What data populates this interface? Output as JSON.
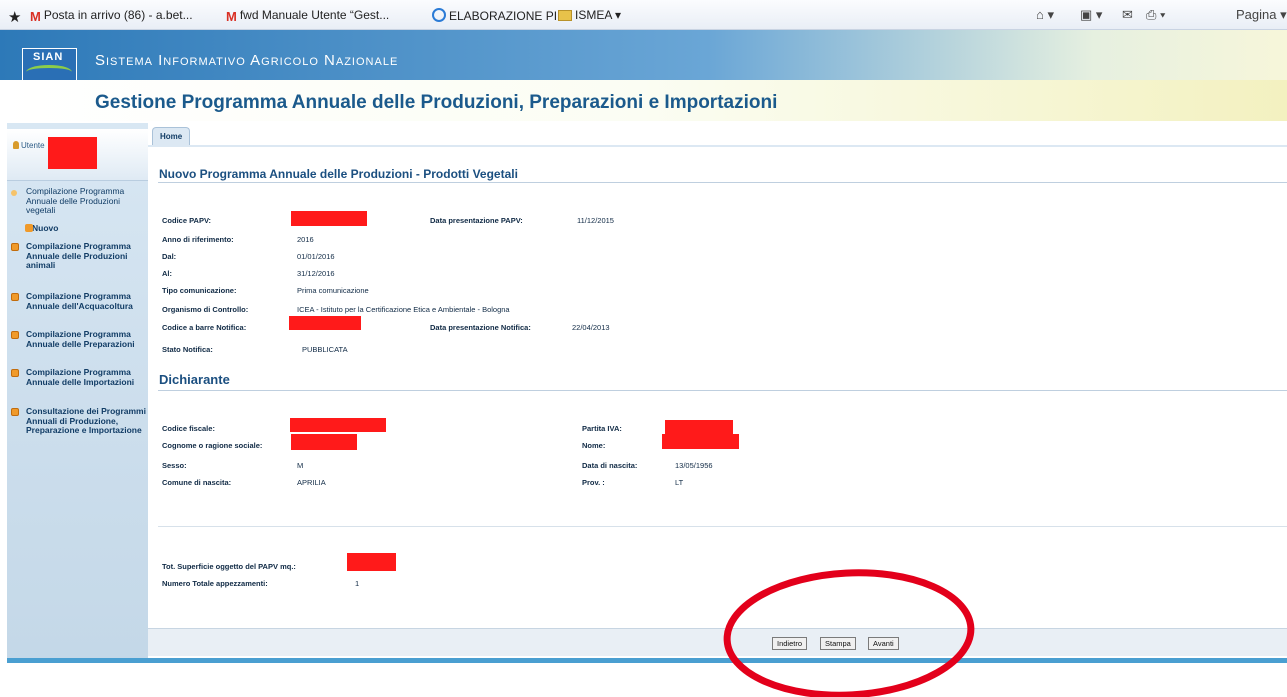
{
  "browser": {
    "favorites": [
      {
        "label": "Posta in arrivo (86) - a.bet...",
        "icon": "gmail-icon"
      },
      {
        "label": "fwd Manuale Utente “Gest...",
        "icon": "gmail-icon"
      },
      {
        "label": "ELABORAZIONE PI",
        "icon": "ie-page-icon"
      },
      {
        "label": "ISMEA ▾",
        "icon": "folder-icon"
      }
    ],
    "pagina_label": "Pagina ▾"
  },
  "header": {
    "logo_text": "SIAN",
    "system_name": "Sistema Informativo Agricolo Nazionale",
    "app_title": "Gestione Programma Annuale delle Produzioni, Preparazioni e Importazioni"
  },
  "sidebar": {
    "user_label": "Utente",
    "items": [
      {
        "label": "Compilazione Programma Annuale delle Produzioni vegetali",
        "bold": false
      },
      {
        "label": "Nuovo",
        "sub": true
      },
      {
        "label": "Compilazione Programma Annuale delle Produzioni animali",
        "bold": true
      },
      {
        "label": "Compilazione Programma Annuale dell'Acquacoltura",
        "bold": true
      },
      {
        "label": "Compilazione Programma Annuale delle Preparazioni",
        "bold": true
      },
      {
        "label": "Compilazione Programma Annuale delle Importazioni",
        "bold": true
      },
      {
        "label": "Consultazione dei Programmi Annuali di Produzione, Preparazione e Importazione",
        "bold": true
      }
    ]
  },
  "main": {
    "home_tab": "Home",
    "section1_title": "Nuovo Programma Annuale delle Produzioni - Prodotti Vegetali",
    "fields1": {
      "codice_papv_label": "Codice PAPV:",
      "data_pres_papv_label": "Data presentazione PAPV:",
      "data_pres_papv_value": "11/12/2015",
      "anno_label": "Anno di riferimento:",
      "anno_value": "2016",
      "dal_label": "Dal:",
      "dal_value": "01/01/2016",
      "al_label": "Al:",
      "al_value": "31/12/2016",
      "tipo_label": "Tipo comunicazione:",
      "tipo_value": "Prima comunicazione",
      "organismo_label": "Organismo di Controllo:",
      "organismo_value": "ICEA - Istituto per la Certificazione Etica e Ambientale - Bologna",
      "codice_barre_label": "Codice a barre Notifica:",
      "data_pres_notifica_label": "Data presentazione Notifica:",
      "data_pres_notifica_value": "22/04/2013",
      "stato_label": "Stato Notifica:",
      "stato_value": "PUBBLICATA"
    },
    "section2_title": "Dichiarante",
    "fields2": {
      "cf_label": "Codice fiscale:",
      "piva_label": "Partita IVA:",
      "cognome_label": "Cognome o ragione sociale:",
      "nome_label": "Nome:",
      "sesso_label": "Sesso:",
      "sesso_value": "M",
      "nascita_label": "Data di nascita:",
      "nascita_value": "13/05/1956",
      "comune_label": "Comune di nascita:",
      "comune_value": "APRILIA",
      "prov_label": "Prov. :",
      "prov_value": "LT"
    },
    "totals": {
      "superficie_label": "Tot. Superficie oggetto del PAPV mq.:",
      "appezzamenti_label": "Numero Totale appezzamenti:",
      "appezzamenti_value": "1"
    },
    "buttons": {
      "indietro": "Indietro",
      "stampa": "Stampa",
      "avanti": "Avanti"
    }
  },
  "colors": {
    "accent": "#1b5a8c",
    "redaction": "#ff1a1a",
    "annotation": "#e3001b"
  }
}
